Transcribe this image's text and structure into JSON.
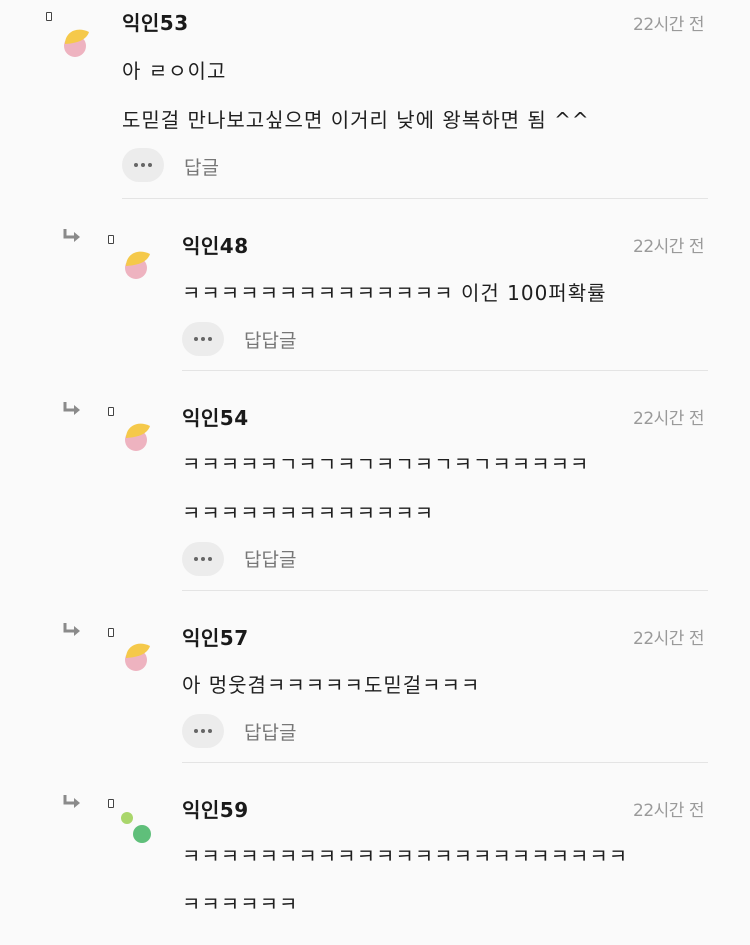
{
  "comments": [
    {
      "nickname": "익인53",
      "time": "22시간 전",
      "lines": [
        "아 ㄹㅇ이고",
        "도믿걸 만나보고싶으면 이거리 낮에 왕복하면 됨 ^^"
      ],
      "reply_label": "답글",
      "avatar": "sun-moon-icon"
    },
    {
      "nickname": "익인48",
      "time": "22시간 전",
      "lines": [
        "ㅋㅋㅋㅋㅋㅋㅋㅋㅋㅋㅋㅋㅋㅋ 이건 100퍼확률"
      ],
      "reply_label": "답답글",
      "avatar": "sun-moon-icon"
    },
    {
      "nickname": "익인54",
      "time": "22시간 전",
      "lines": [
        "ㅋㅋㅋㅋㅋㄱㅋㄱㅋㄱㅋㄱㅋㄱㅋㄱㅋㅋㅋㅋㅋ",
        "ㅋㅋㅋㅋㅋㅋㅋㅋㅋㅋㅋㅋㅋ"
      ],
      "reply_label": "답답글",
      "avatar": "sun-moon-icon"
    },
    {
      "nickname": "익인57",
      "time": "22시간 전",
      "lines": [
        "아 멍웃겸ㅋㅋㅋㅋㅋ도믿걸ㅋㅋㅋ"
      ],
      "reply_label": "답답글",
      "avatar": "sun-moon-icon"
    },
    {
      "nickname": "익인59",
      "time": "22시간 전",
      "lines": [
        "ㅋㅋㅋㅋㅋㅋㅋㅋㅋㅋㅋㅋㅋㅋㅋㅋㅋㅋㅋㅋㅋㅋㅋ",
        "ㅋㅋㅋㅋㅋㅋ"
      ],
      "reply_label": "",
      "avatar": "green-dots-icon"
    }
  ],
  "colors": {
    "avatar_yellow": "#f5c94a",
    "avatar_pink": "#eeb3c0",
    "avatar_green_light": "#a9d66b",
    "avatar_green_dark": "#5fbf7a"
  }
}
